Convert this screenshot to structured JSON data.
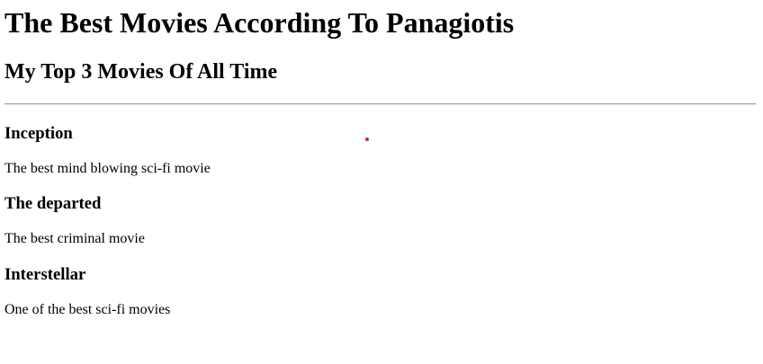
{
  "page": {
    "title": "The Best Movies According To Panagiotis",
    "subtitle": "My Top 3 Movies Of All Time"
  },
  "movies": [
    {
      "title": "Inception",
      "description": "The best mind blowing sci-fi movie"
    },
    {
      "title": "The departed",
      "description": "The best criminal movie"
    },
    {
      "title": "Interstellar",
      "description": "One of the best sci-fi movies"
    }
  ],
  "colors": {
    "text": "#000000",
    "divider": "#9a9a9a",
    "cursor_dot": "#e02020",
    "background": "#ffffff"
  }
}
